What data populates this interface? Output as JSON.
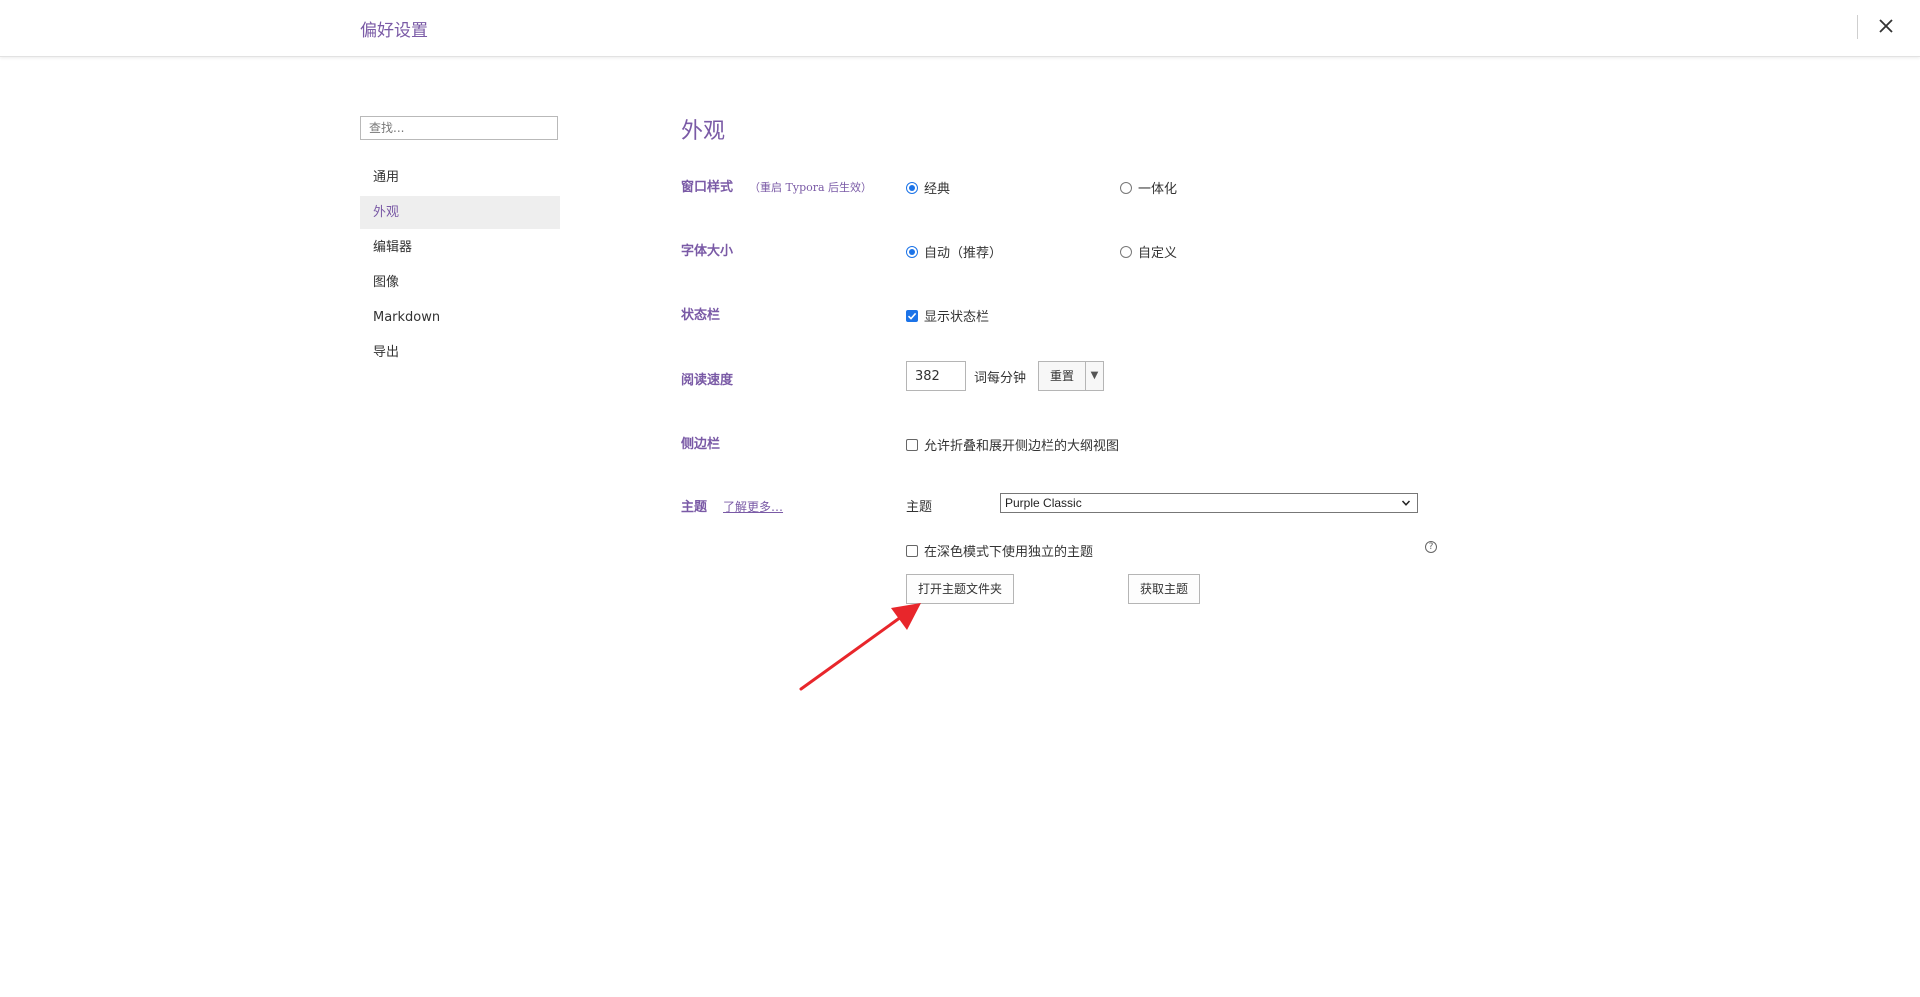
{
  "window": {
    "title": "偏好设置"
  },
  "sidebar": {
    "search_placeholder": "查找...",
    "items": [
      {
        "label": "通用"
      },
      {
        "label": "外观"
      },
      {
        "label": "编辑器"
      },
      {
        "label": "图像"
      },
      {
        "label": "Markdown"
      },
      {
        "label": "导出"
      }
    ],
    "active_index": 1
  },
  "main": {
    "section_title": "外观",
    "window_style": {
      "label": "窗口样式",
      "note": "（重启 Typora 后生效）",
      "options": [
        "经典",
        "一体化"
      ],
      "selected": "经典"
    },
    "font_size": {
      "label": "字体大小",
      "options": [
        "自动（推荐）",
        "自定义"
      ],
      "selected": "自动（推荐）"
    },
    "status_bar": {
      "label": "状态栏",
      "checkbox_label": "显示状态栏",
      "checked": true
    },
    "reading_speed": {
      "label": "阅读速度",
      "value": "382",
      "unit": "词每分钟",
      "reset_label": "重置",
      "dropdown_glyph": "▼"
    },
    "sidebar_setting": {
      "label": "侧边栏",
      "checkbox_label": "允许折叠和展开侧边栏的大纲视图",
      "checked": false
    },
    "theme": {
      "label": "主题",
      "learn_more": "了解更多…",
      "field_label": "主题",
      "selected_theme": "Purple Classic",
      "dark_mode_label": "在深色模式下使用独立的主题",
      "dark_mode_checked": false,
      "help_glyph": "?",
      "open_folder_label": "打开主题文件夹",
      "get_themes_label": "获取主题"
    }
  },
  "colors": {
    "accent": "#7a5aa6",
    "control_blue": "#1b73e8",
    "annotation_red": "#e8262b"
  }
}
